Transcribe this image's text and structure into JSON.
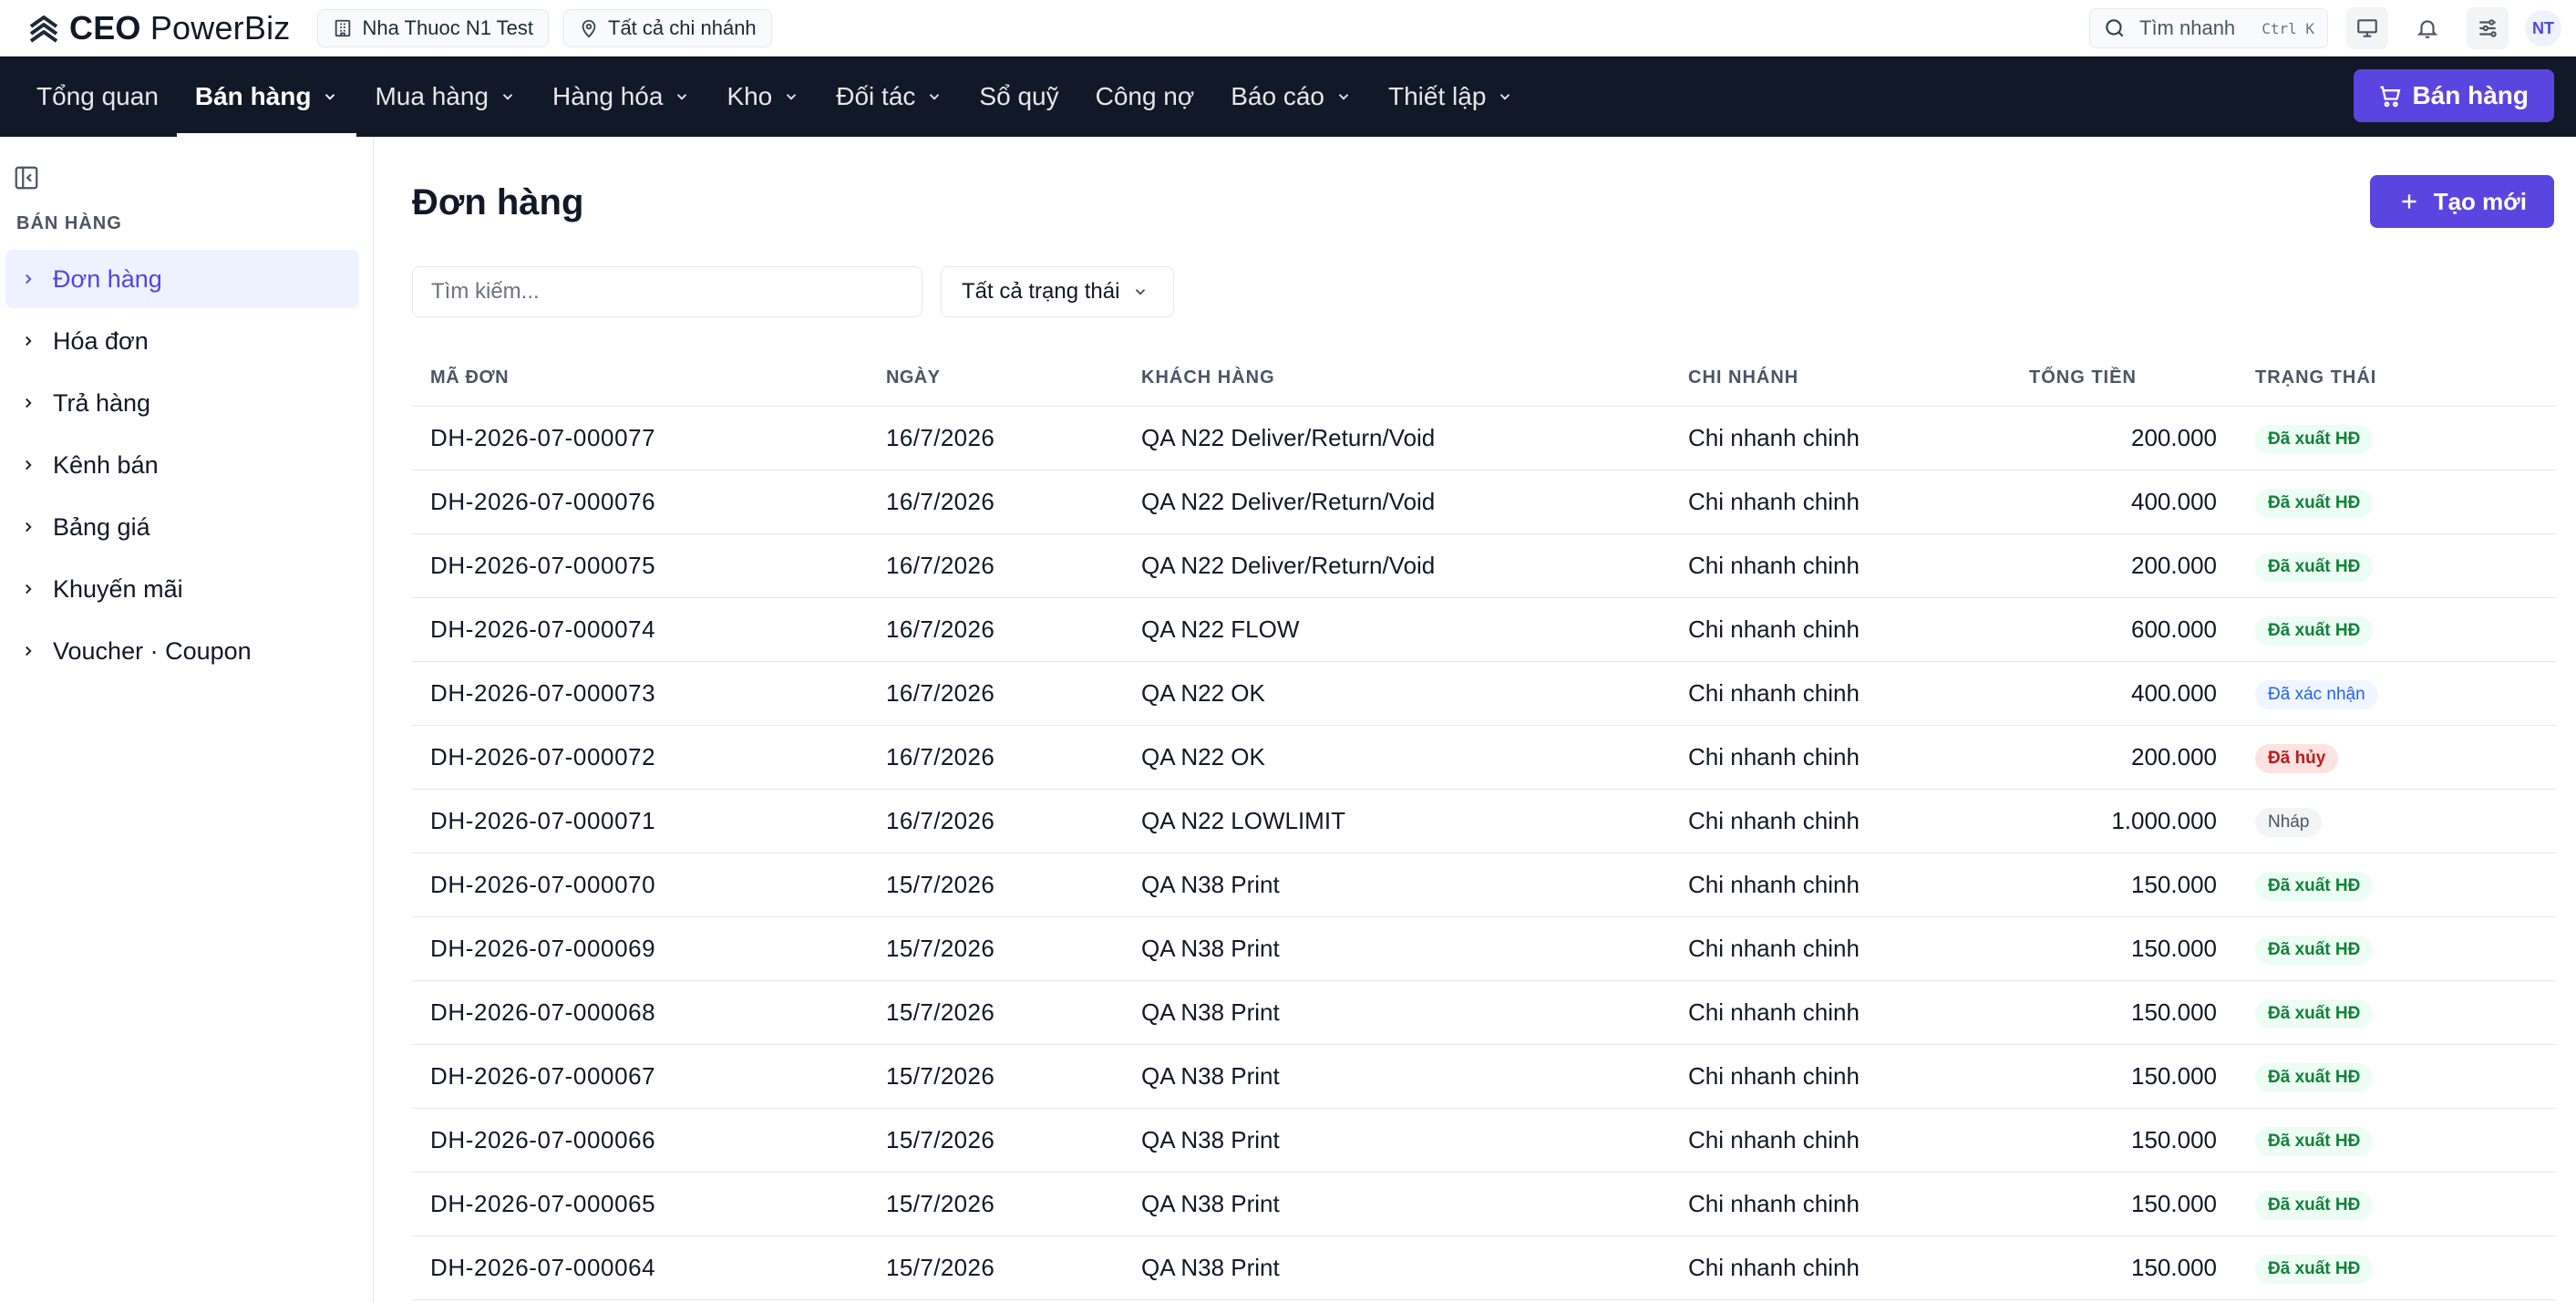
{
  "app": {
    "brand_bold": "CEO",
    "brand_light": "PowerBiz",
    "store": "Nha Thuoc N1 Test",
    "branch_scope": "Tất cả chi nhánh"
  },
  "topbar": {
    "quick_search": "Tìm nhanh",
    "shortcut": "Ctrl K",
    "avatar_initials": "NT"
  },
  "nav": {
    "items": [
      {
        "label": "Tổng quan",
        "dropdown": false
      },
      {
        "label": "Bán hàng",
        "dropdown": true,
        "active": true
      },
      {
        "label": "Mua hàng",
        "dropdown": true
      },
      {
        "label": "Hàng hóa",
        "dropdown": true
      },
      {
        "label": "Kho",
        "dropdown": true
      },
      {
        "label": "Đối tác",
        "dropdown": true
      },
      {
        "label": "Sổ quỹ",
        "dropdown": false
      },
      {
        "label": "Công nợ",
        "dropdown": false
      },
      {
        "label": "Báo cáo",
        "dropdown": true
      },
      {
        "label": "Thiết lập",
        "dropdown": true
      }
    ],
    "sell_button": "Bán hàng"
  },
  "sidebar": {
    "section": "BÁN HÀNG",
    "items": [
      {
        "label": "Đơn hàng",
        "active": true
      },
      {
        "label": "Hóa đơn"
      },
      {
        "label": "Trả hàng"
      },
      {
        "label": "Kênh bán"
      },
      {
        "label": "Bảng giá"
      },
      {
        "label": "Khuyến mãi"
      },
      {
        "label": "Voucher · Coupon"
      }
    ]
  },
  "main": {
    "title": "Đơn hàng",
    "create_button": "Tạo mới",
    "search_placeholder": "Tìm kiếm...",
    "status_filter": "Tất cả trạng thái"
  },
  "table": {
    "headers": [
      "MÃ ĐƠN",
      "NGÀY",
      "KHÁCH HÀNG",
      "CHI NHÁNH",
      "TỔNG TIỀN",
      "TRẠNG THÁI"
    ],
    "rows": [
      {
        "code": "DH-2026-07-000077",
        "date": "16/7/2026",
        "customer": "QA N22 Deliver/Return/Void",
        "branch": "Chi nhanh chinh",
        "total": "200.000",
        "status": "Đã xuất HĐ",
        "tone": "green"
      },
      {
        "code": "DH-2026-07-000076",
        "date": "16/7/2026",
        "customer": "QA N22 Deliver/Return/Void",
        "branch": "Chi nhanh chinh",
        "total": "400.000",
        "status": "Đã xuất HĐ",
        "tone": "green"
      },
      {
        "code": "DH-2026-07-000075",
        "date": "16/7/2026",
        "customer": "QA N22 Deliver/Return/Void",
        "branch": "Chi nhanh chinh",
        "total": "200.000",
        "status": "Đã xuất HĐ",
        "tone": "green"
      },
      {
        "code": "DH-2026-07-000074",
        "date": "16/7/2026",
        "customer": "QA N22 FLOW",
        "branch": "Chi nhanh chinh",
        "total": "600.000",
        "status": "Đã xuất HĐ",
        "tone": "green"
      },
      {
        "code": "DH-2026-07-000073",
        "date": "16/7/2026",
        "customer": "QA N22 OK",
        "branch": "Chi nhanh chinh",
        "total": "400.000",
        "status": "Đã xác nhận",
        "tone": "blue"
      },
      {
        "code": "DH-2026-07-000072",
        "date": "16/7/2026",
        "customer": "QA N22 OK",
        "branch": "Chi nhanh chinh",
        "total": "200.000",
        "status": "Đã hủy",
        "tone": "red"
      },
      {
        "code": "DH-2026-07-000071",
        "date": "16/7/2026",
        "customer": "QA N22 LOWLIMIT",
        "branch": "Chi nhanh chinh",
        "total": "1.000.000",
        "status": "Nháp",
        "tone": "gray"
      },
      {
        "code": "DH-2026-07-000070",
        "date": "15/7/2026",
        "customer": "QA N38 Print",
        "branch": "Chi nhanh chinh",
        "total": "150.000",
        "status": "Đã xuất HĐ",
        "tone": "green"
      },
      {
        "code": "DH-2026-07-000069",
        "date": "15/7/2026",
        "customer": "QA N38 Print",
        "branch": "Chi nhanh chinh",
        "total": "150.000",
        "status": "Đã xuất HĐ",
        "tone": "green"
      },
      {
        "code": "DH-2026-07-000068",
        "date": "15/7/2026",
        "customer": "QA N38 Print",
        "branch": "Chi nhanh chinh",
        "total": "150.000",
        "status": "Đã xuất HĐ",
        "tone": "green"
      },
      {
        "code": "DH-2026-07-000067",
        "date": "15/7/2026",
        "customer": "QA N38 Print",
        "branch": "Chi nhanh chinh",
        "total": "150.000",
        "status": "Đã xuất HĐ",
        "tone": "green"
      },
      {
        "code": "DH-2026-07-000066",
        "date": "15/7/2026",
        "customer": "QA N38 Print",
        "branch": "Chi nhanh chinh",
        "total": "150.000",
        "status": "Đã xuất HĐ",
        "tone": "green"
      },
      {
        "code": "DH-2026-07-000065",
        "date": "15/7/2026",
        "customer": "QA N38 Print",
        "branch": "Chi nhanh chinh",
        "total": "150.000",
        "status": "Đã xuất HĐ",
        "tone": "green"
      },
      {
        "code": "DH-2026-07-000064",
        "date": "15/7/2026",
        "customer": "QA N38 Print",
        "branch": "Chi nhanh chinh",
        "total": "150.000",
        "status": "Đã xuất HĐ",
        "tone": "green"
      }
    ]
  },
  "icons": {
    "logo": "chevrons-up-logo-icon",
    "store": "building-icon",
    "branch": "map-pin-icon",
    "search": "search-icon",
    "monitor": "monitor-icon",
    "bell": "bell-icon",
    "settings": "sliders-icon",
    "cart": "cart-icon",
    "plus": "plus-icon",
    "collapse": "sidebar-collapse-icon"
  },
  "colors": {
    "accent": "#5b45e0",
    "nav_bg": "#111827",
    "active_bg": "#eef2ff"
  }
}
